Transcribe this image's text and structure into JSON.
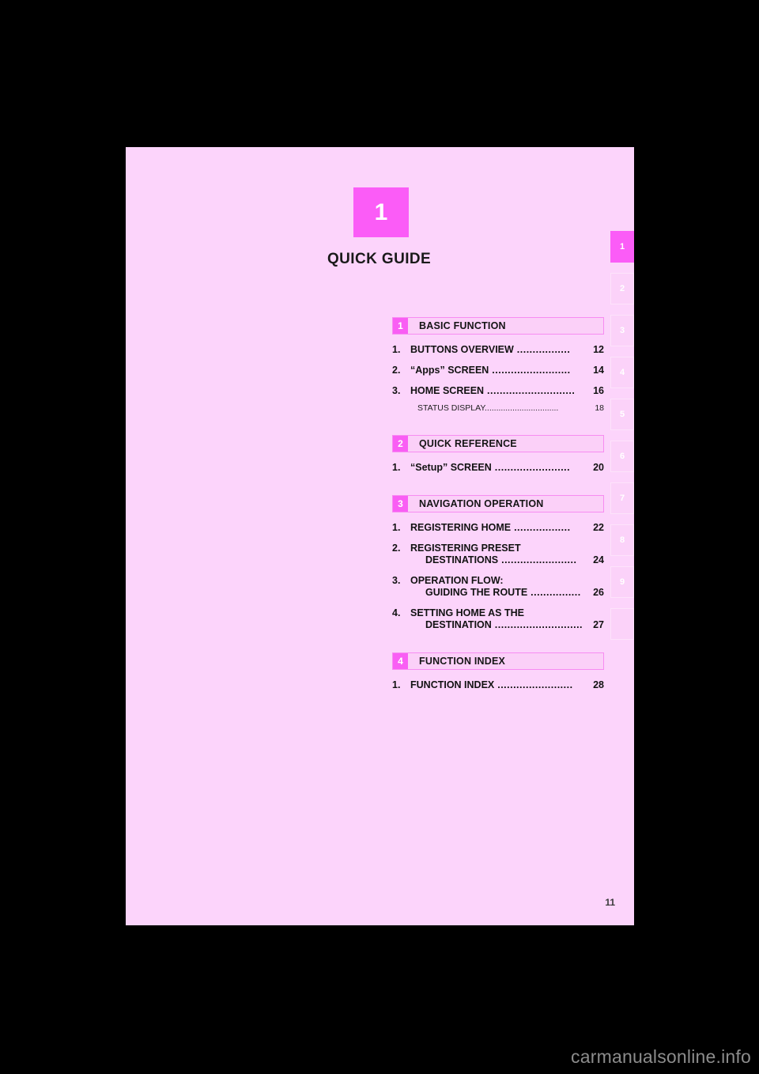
{
  "page": {
    "chapter_number": "1",
    "chapter_title": "QUICK GUIDE",
    "page_number": "11",
    "watermark": "carmanualsonline.info",
    "colors": {
      "page_background": "#fcd4fb",
      "accent_magenta": "#fb5cf7",
      "header_bar_fill": "#fbd0f8",
      "header_bar_border": "#f78cf2",
      "tab_inactive": "#fbd2f9",
      "text": "#121212"
    }
  },
  "sections": [
    {
      "number": "1",
      "label": "BASIC FUNCTION",
      "entries": [
        {
          "index": "1.",
          "line1": "BUTTONS OVERVIEW",
          "leader": ".................",
          "page": "12"
        },
        {
          "index": "2.",
          "line1": "“Apps” SCREEN",
          "leader": ".........................",
          "page": "14"
        },
        {
          "index": "3.",
          "line1": "HOME SCREEN",
          "leader": "............................",
          "page": "16",
          "sub": {
            "label": "STATUS DISPLAY",
            "leader": "................................",
            "page": "18"
          }
        }
      ]
    },
    {
      "number": "2",
      "label": "QUICK REFERENCE",
      "entries": [
        {
          "index": "1.",
          "line1": "“Setup” SCREEN",
          "leader": "........................",
          "page": "20"
        }
      ]
    },
    {
      "number": "3",
      "label": "NAVIGATION OPERATION",
      "entries": [
        {
          "index": "1.",
          "line1": "REGISTERING HOME",
          "leader": "..................",
          "page": "22"
        },
        {
          "index": "2.",
          "line1": "REGISTERING PRESET",
          "line2": "DESTINATIONS",
          "leader": "........................",
          "page": "24"
        },
        {
          "index": "3.",
          "line1": "OPERATION FLOW:",
          "line2": "GUIDING THE ROUTE",
          "leader": "................",
          "page": "26"
        },
        {
          "index": "4.",
          "line1": "SETTING HOME AS THE",
          "line2": "DESTINATION",
          "leader": "............................",
          "page": "27"
        }
      ]
    },
    {
      "number": "4",
      "label": "FUNCTION INDEX",
      "entries": [
        {
          "index": "1.",
          "line1": "FUNCTION INDEX",
          "leader": "........................",
          "page": "28"
        }
      ]
    }
  ],
  "tab_strip": [
    {
      "label": "1",
      "active": true
    },
    {
      "label": "2",
      "active": false
    },
    {
      "label": "3",
      "active": false
    },
    {
      "label": "4",
      "active": false
    },
    {
      "label": "5",
      "active": false
    },
    {
      "label": "6",
      "active": false
    },
    {
      "label": "7",
      "active": false
    },
    {
      "label": "8",
      "active": false
    },
    {
      "label": "9",
      "active": false
    },
    {
      "label": "",
      "active": false
    }
  ]
}
